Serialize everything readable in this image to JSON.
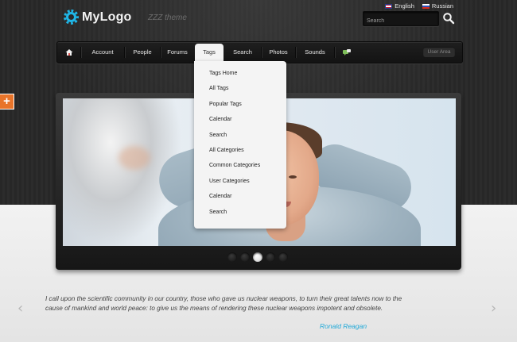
{
  "header": {
    "logo_text": "MyLogo",
    "theme_label": "ZZZ theme",
    "languages": [
      {
        "label": "English"
      },
      {
        "label": "Russian"
      }
    ],
    "search": {
      "placeholder": "Search"
    }
  },
  "nav": {
    "home_icon": "home-icon",
    "items": [
      {
        "label": "Account"
      },
      {
        "label": "People"
      },
      {
        "label": "Forums"
      },
      {
        "label": "Tags",
        "active": true
      },
      {
        "label": "Search"
      },
      {
        "label": "Photos"
      },
      {
        "label": "Sounds"
      }
    ],
    "extra_icon": "chat-icon",
    "user_area": "User Area"
  },
  "tags_menu": {
    "items": [
      "Tags Home",
      "All Tags",
      "Popular Tags",
      "Calendar",
      "Search",
      "All Categories",
      "Common Categories",
      "User Categories",
      "Calendar",
      "Search"
    ]
  },
  "slider": {
    "slide_count": 5,
    "active_index": 2
  },
  "quote": {
    "text": "I call upon the scientific community in our country, those who gave us nuclear weapons, to turn their great talents now to the cause of mankind and world peace: to give us the means of rendering these nuclear weapons impotent and obsolete.",
    "author": "Ronald Reagan"
  },
  "colors": {
    "accent": "#21a9d8",
    "logo_gear": "#1fb7e8",
    "plus_tab": "#e8742a"
  },
  "side_tab": {
    "icon": "plus-icon",
    "glyph": "+"
  }
}
